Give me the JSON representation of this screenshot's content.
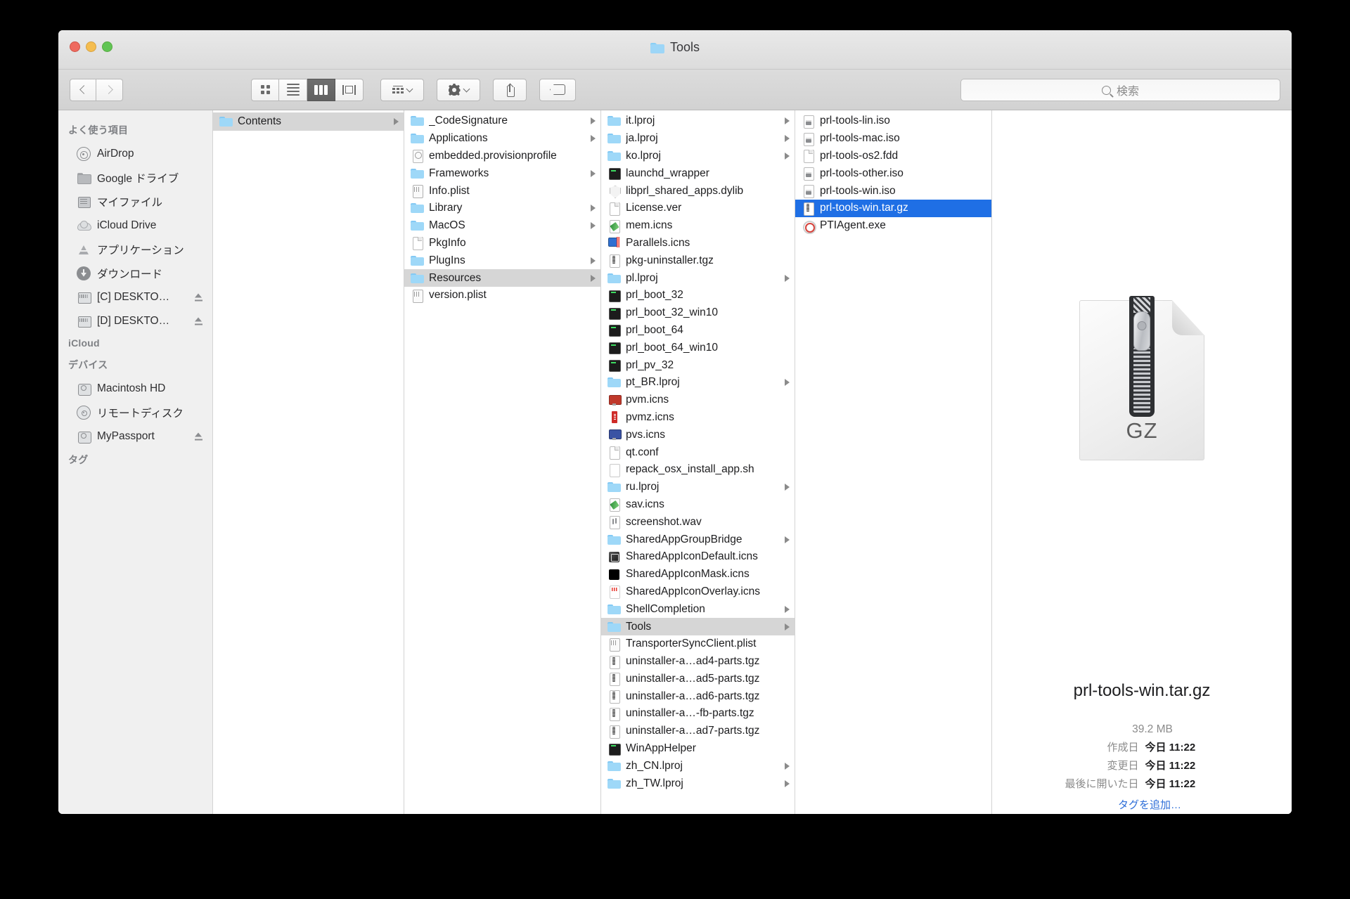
{
  "window": {
    "title": "Tools",
    "traffic_lights": [
      "close",
      "minimize",
      "zoom"
    ]
  },
  "toolbar": {
    "back": "back",
    "forward": "forward",
    "view_icon": "icon-view",
    "view_list": "list-view",
    "view_column": "column-view",
    "view_cover": "cover-flow-view",
    "arrange": "arrange",
    "action": "action",
    "share": "share",
    "tags": "tags",
    "search_placeholder": "検索"
  },
  "sidebar": {
    "sections": [
      {
        "title": "よく使う項目",
        "items": [
          {
            "label": "AirDrop",
            "icon": "airdrop-icon",
            "eject": false
          },
          {
            "label": "Google ドライブ",
            "icon": "folder-grey-icon",
            "eject": false
          },
          {
            "label": "マイファイル",
            "icon": "my-files-icon",
            "eject": false
          },
          {
            "label": "iCloud Drive",
            "icon": "cloud-icon",
            "eject": false
          },
          {
            "label": "アプリケーション",
            "icon": "applications-icon",
            "eject": false
          },
          {
            "label": "ダウンロード",
            "icon": "downloads-icon",
            "eject": false
          },
          {
            "label": "[C] DESKTO…",
            "icon": "external-drive-icon",
            "eject": true
          },
          {
            "label": "[D] DESKTO…",
            "icon": "external-drive-icon",
            "eject": true
          }
        ]
      },
      {
        "title": "iCloud",
        "items": []
      },
      {
        "title": "デバイス",
        "items": [
          {
            "label": "Macintosh HD",
            "icon": "hard-drive-icon",
            "eject": false
          },
          {
            "label": "リモートディスク",
            "icon": "disc-icon",
            "eject": false
          },
          {
            "label": "MyPassport",
            "icon": "hard-drive-icon",
            "eject": true
          }
        ]
      },
      {
        "title": "タグ",
        "items": []
      }
    ]
  },
  "columns": [
    {
      "name": "column-1",
      "items": [
        {
          "label": "Contents",
          "icon": "folder",
          "arrow": true,
          "state": "selected-grey"
        }
      ]
    },
    {
      "name": "column-2",
      "items": [
        {
          "label": "_CodeSignature",
          "icon": "folder",
          "arrow": true,
          "state": ""
        },
        {
          "label": "Applications",
          "icon": "folder",
          "arrow": true,
          "state": ""
        },
        {
          "label": "embedded.provisionprofile",
          "icon": "prov",
          "arrow": false,
          "state": ""
        },
        {
          "label": "Frameworks",
          "icon": "folder",
          "arrow": true,
          "state": ""
        },
        {
          "label": "Info.plist",
          "icon": "plist",
          "arrow": false,
          "state": ""
        },
        {
          "label": "Library",
          "icon": "folder",
          "arrow": true,
          "state": ""
        },
        {
          "label": "MacOS",
          "icon": "folder",
          "arrow": true,
          "state": ""
        },
        {
          "label": "PkgInfo",
          "icon": "doc",
          "arrow": false,
          "state": ""
        },
        {
          "label": "PlugIns",
          "icon": "folder",
          "arrow": true,
          "state": ""
        },
        {
          "label": "Resources",
          "icon": "folder",
          "arrow": true,
          "state": "selected-grey"
        },
        {
          "label": "version.plist",
          "icon": "plist",
          "arrow": false,
          "state": ""
        }
      ]
    },
    {
      "name": "column-3",
      "items": [
        {
          "label": "it.lproj",
          "icon": "folder",
          "arrow": true,
          "state": ""
        },
        {
          "label": "ja.lproj",
          "icon": "folder",
          "arrow": true,
          "state": ""
        },
        {
          "label": "ko.lproj",
          "icon": "folder",
          "arrow": true,
          "state": ""
        },
        {
          "label": "launchd_wrapper",
          "icon": "term",
          "arrow": false,
          "state": ""
        },
        {
          "label": "libprl_shared_apps.dylib",
          "icon": "shield",
          "arrow": false,
          "state": ""
        },
        {
          "label": "License.ver",
          "icon": "doc",
          "arrow": false,
          "state": ""
        },
        {
          "label": "mem.icns",
          "icon": "icns",
          "arrow": false,
          "state": ""
        },
        {
          "label": "Parallels.icns",
          "icon": "parallels",
          "arrow": false,
          "state": ""
        },
        {
          "label": "pkg-uninstaller.tgz",
          "icon": "tgz",
          "arrow": false,
          "state": ""
        },
        {
          "label": "pl.lproj",
          "icon": "folder",
          "arrow": true,
          "state": ""
        },
        {
          "label": "prl_boot_32",
          "icon": "term",
          "arrow": false,
          "state": ""
        },
        {
          "label": "prl_boot_32_win10",
          "icon": "term",
          "arrow": false,
          "state": ""
        },
        {
          "label": "prl_boot_64",
          "icon": "term",
          "arrow": false,
          "state": ""
        },
        {
          "label": "prl_boot_64_win10",
          "icon": "term",
          "arrow": false,
          "state": ""
        },
        {
          "label": "prl_pv_32",
          "icon": "term",
          "arrow": false,
          "state": ""
        },
        {
          "label": "pt_BR.lproj",
          "icon": "folder",
          "arrow": true,
          "state": ""
        },
        {
          "label": "pvm.icns",
          "icon": "pvm",
          "arrow": false,
          "state": ""
        },
        {
          "label": "pvmz.icns",
          "icon": "pvmz",
          "arrow": false,
          "state": ""
        },
        {
          "label": "pvs.icns",
          "icon": "pvs",
          "arrow": false,
          "state": ""
        },
        {
          "label": "qt.conf",
          "icon": "doc",
          "arrow": false,
          "state": ""
        },
        {
          "label": "repack_osx_install_app.sh",
          "icon": "sh",
          "arrow": false,
          "state": ""
        },
        {
          "label": "ru.lproj",
          "icon": "folder",
          "arrow": true,
          "state": ""
        },
        {
          "label": "sav.icns",
          "icon": "icns",
          "arrow": false,
          "state": ""
        },
        {
          "label": "screenshot.wav",
          "icon": "wav",
          "arrow": false,
          "state": ""
        },
        {
          "label": "SharedAppGroupBridge",
          "icon": "folder",
          "arrow": true,
          "state": ""
        },
        {
          "label": "SharedAppIconDefault.icns",
          "icon": "appicon",
          "arrow": false,
          "state": ""
        },
        {
          "label": "SharedAppIconMask.icns",
          "icon": "mask",
          "arrow": false,
          "state": ""
        },
        {
          "label": "SharedAppIconOverlay.icns",
          "icon": "overlay",
          "arrow": false,
          "state": ""
        },
        {
          "label": "ShellCompletion",
          "icon": "folder",
          "arrow": true,
          "state": ""
        },
        {
          "label": "Tools",
          "icon": "folder",
          "arrow": true,
          "state": "selected-grey"
        },
        {
          "label": "TransporterSyncClient.plist",
          "icon": "plist",
          "arrow": false,
          "state": ""
        },
        {
          "label": "uninstaller-a…ad4-parts.tgz",
          "icon": "tgz",
          "arrow": false,
          "state": ""
        },
        {
          "label": "uninstaller-a…ad5-parts.tgz",
          "icon": "tgz",
          "arrow": false,
          "state": ""
        },
        {
          "label": "uninstaller-a…ad6-parts.tgz",
          "icon": "tgz",
          "arrow": false,
          "state": ""
        },
        {
          "label": "uninstaller-a…-fb-parts.tgz",
          "icon": "tgz",
          "arrow": false,
          "state": ""
        },
        {
          "label": "uninstaller-a…ad7-parts.tgz",
          "icon": "tgz",
          "arrow": false,
          "state": ""
        },
        {
          "label": "WinAppHelper",
          "icon": "term",
          "arrow": false,
          "state": ""
        },
        {
          "label": "zh_CN.lproj",
          "icon": "folder",
          "arrow": true,
          "state": ""
        },
        {
          "label": "zh_TW.lproj",
          "icon": "folder",
          "arrow": true,
          "state": ""
        }
      ]
    },
    {
      "name": "column-4",
      "items": [
        {
          "label": "prl-tools-lin.iso",
          "icon": "iso",
          "arrow": false,
          "state": ""
        },
        {
          "label": "prl-tools-mac.iso",
          "icon": "iso",
          "arrow": false,
          "state": ""
        },
        {
          "label": "prl-tools-os2.fdd",
          "icon": "doc",
          "arrow": false,
          "state": ""
        },
        {
          "label": "prl-tools-other.iso",
          "icon": "iso",
          "arrow": false,
          "state": ""
        },
        {
          "label": "prl-tools-win.iso",
          "icon": "iso",
          "arrow": false,
          "state": ""
        },
        {
          "label": "prl-tools-win.tar.gz",
          "icon": "tgz",
          "arrow": false,
          "state": "selected-blue"
        },
        {
          "label": "PTIAgent.exe",
          "icon": "exe",
          "arrow": false,
          "state": ""
        }
      ]
    }
  ],
  "preview": {
    "icon_label": "GZ",
    "file_name": "prl-tools-win.tar.gz",
    "size": "39.2 MB",
    "fields": [
      {
        "key": "作成日",
        "value": "今日 11:22"
      },
      {
        "key": "変更日",
        "value": "今日 11:22"
      },
      {
        "key": "最後に開いた日",
        "value": "今日 11:22"
      }
    ],
    "add_tags": "タグを追加…"
  },
  "colors": {
    "selection_blue": "#1f6fe5",
    "selection_grey": "#d6d6d6",
    "folder_blue": "#9ed8f8",
    "link_blue": "#2f6fd8"
  }
}
